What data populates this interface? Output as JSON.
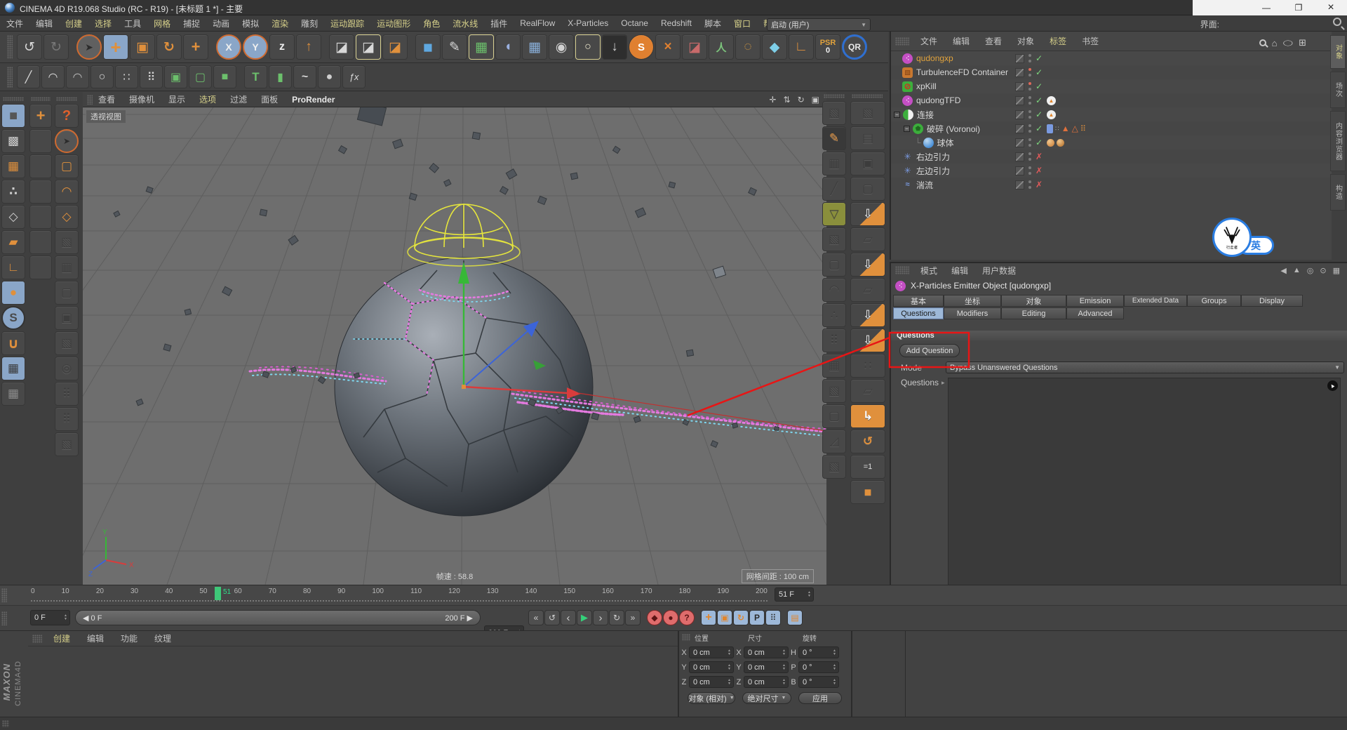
{
  "window": {
    "title": "CINEMA 4D R19.068 Studio (RC - R19) - [未标题 1 *] - 主要",
    "minimize": "—",
    "restore": "❐",
    "close": "×"
  },
  "menu": {
    "items": [
      {
        "t": "文件"
      },
      {
        "t": "编辑"
      },
      {
        "t": "创建",
        "css": "color:#d6d08a"
      },
      {
        "t": "选择",
        "css": "color:#d6d08a"
      },
      {
        "t": "工具"
      },
      {
        "t": "网格",
        "css": "color:#d6d08a"
      },
      {
        "t": "捕捉"
      },
      {
        "t": "动画"
      },
      {
        "t": "模拟"
      },
      {
        "t": "渲染",
        "css": "color:#d6d08a"
      },
      {
        "t": "雕刻"
      },
      {
        "t": "运动跟踪",
        "css": "color:#d6d08a"
      },
      {
        "t": "运动图形",
        "css": "color:#d6d08a"
      },
      {
        "t": "角色",
        "css": "color:#d6d08a"
      },
      {
        "t": "流水线",
        "css": "color:#d6d08a"
      },
      {
        "t": "插件"
      },
      {
        "t": "RealFlow"
      },
      {
        "t": "X-Particles"
      },
      {
        "t": "Octane"
      },
      {
        "t": "Redshift"
      },
      {
        "t": "脚本"
      },
      {
        "t": "窗口",
        "css": "color:#d6d08a"
      },
      {
        "t": "帮助",
        "css": "color:#d6d08a"
      }
    ],
    "interface_label": "界面:",
    "interface_value": "启动 (用户)"
  },
  "toolbar_main": {
    "icons": [
      {
        "n": "undo-icon",
        "g": "↺",
        "css": "color:#d8d8d8"
      },
      {
        "n": "redo-icon",
        "g": "↻",
        "css": "color:#777"
      },
      {
        "n": "sep",
        "g": "",
        "css": "width:7px;background:none;border:none;box-shadow:none"
      },
      {
        "n": "live-selection-icon",
        "g": "➤",
        "css": "color:#2b2b2b;background:#606060;border:2px solid #cf6a30;border-radius:50%;font-size:14px"
      },
      {
        "n": "move-tool-icon",
        "g": "+",
        "css": "background:#8aa6c8;color:#e0903c;font-weight:bold;font-size:26px"
      },
      {
        "n": "scale-tool-icon",
        "g": "▣",
        "css": "color:#e0903c"
      },
      {
        "n": "rotate-tool-icon",
        "g": "↻",
        "css": "color:#e0903c;font-weight:bold"
      },
      {
        "n": "last-tool-icon",
        "g": "+",
        "css": "color:#e0903c;font-weight:bold;font-size:22px"
      },
      {
        "n": "sep",
        "g": "",
        "css": "width:7px;background:none;border:none;box-shadow:none"
      },
      {
        "n": "lock-x-axis-icon",
        "g": "X",
        "css": "background:#8aa6c8;color:#f0f0f0;border:2px solid #cf6a30;border-radius:50%;font-weight:bold;font-size:14px"
      },
      {
        "n": "lock-y-axis-icon",
        "g": "Y",
        "css": "background:#8aa6c8;color:#f0f0f0;border:2px solid #cf6a30;border-radius:50%;font-weight:bold;font-size:14px"
      },
      {
        "n": "lock-z-axis-icon",
        "g": "z",
        "css": "color:#ececec;font-weight:bold;font-size:16px"
      },
      {
        "n": "coord-system-icon",
        "g": "↑",
        "css": "color:#e0903c;font-weight:bold"
      },
      {
        "n": "sep",
        "g": "",
        "css": "width:7px;background:none;border:none;box-shadow:none"
      },
      {
        "n": "render-view-icon",
        "g": "◪",
        "css": "color:#d8d8d8"
      },
      {
        "n": "render-settings-icon",
        "g": "◪",
        "css": "color:#d8d8d8;border:1px solid #d8d092"
      },
      {
        "n": "render-menu-icon",
        "g": "◪",
        "css": "color:#e0903c"
      },
      {
        "n": "sep",
        "g": "",
        "css": "width:7px;background:none;border:none;box-shadow:none"
      },
      {
        "n": "add-primitive-icon",
        "g": "■",
        "css": "color:#5fa8e0;font-size:23px"
      },
      {
        "n": "spline-pen-icon",
        "g": "✎",
        "css": "color:#d8d8d8"
      },
      {
        "n": "subdivision-surface-icon",
        "g": "▦",
        "css": "color:#6cc06c;border:1px solid #d8d092"
      },
      {
        "n": "deformer-icon",
        "g": "◖",
        "css": "color:#9ab0e0"
      },
      {
        "n": "workplane-icon",
        "g": "▦",
        "css": "color:#88aed8"
      },
      {
        "n": "camera-icon",
        "g": "◉",
        "css": "color:#d0d0d0"
      },
      {
        "n": "light-icon",
        "g": "○",
        "css": "color:#f2ecd2;border:1px solid #d8d092;font-size:16px"
      },
      {
        "n": "floor-icon",
        "g": "↓",
        "css": "background:#2e2e2e;color:#cfcfcf"
      },
      {
        "n": "sky-icon",
        "g": "S",
        "css": "background:#e08030;color:#fff;border-radius:50%;font-weight:bold;font-size:15px"
      },
      {
        "n": "xpresso-icon",
        "g": "×",
        "css": "color:#e08030;font-weight:bold"
      },
      {
        "n": "stage-icon",
        "g": "◪",
        "css": "color:#c86a6a"
      },
      {
        "n": "character-icon",
        "g": "人",
        "css": "color:#7cc47c;font-weight:bold;font-size:15px"
      },
      {
        "n": "hair-icon",
        "g": "◌",
        "css": "color:#e0a040;font-weight:bold"
      },
      {
        "n": "cloth-icon",
        "g": "◆",
        "css": "color:#7ecfe8"
      },
      {
        "n": "mograph-icon",
        "g": "∟",
        "css": "color:#e0903c;font-weight:bold"
      }
    ]
  },
  "toolbar_tools": {
    "icons": [
      {
        "n": "knife-tool-icon",
        "g": "╱",
        "css": "color:#d8d8d8"
      },
      {
        "n": "brush-tool-icon",
        "g": "◠",
        "css": "color:#d8d8d8"
      },
      {
        "n": "spline-arc-icon",
        "g": "◠",
        "css": "color:#b8b8b8"
      },
      {
        "n": "spline-circle-icon",
        "g": "○",
        "css": "color:#d8d8d8"
      },
      {
        "n": "array-tool-icon",
        "g": "∷",
        "css": "color:#d8d8d8"
      },
      {
        "n": "cluster-tool-icon",
        "g": "⠿",
        "css": "color:#d8d8d8"
      },
      {
        "n": "gear-cube-icon",
        "g": "▣",
        "css": "color:#6cc06c"
      },
      {
        "n": "cage-deform-icon",
        "g": "▢",
        "css": "color:#6cc06c"
      },
      {
        "n": "green-cube-icon",
        "g": "■",
        "css": "color:#6cc06c"
      },
      {
        "n": "sep",
        "g": "",
        "css": "width:7px;background:none;border:none;box-shadow:none"
      },
      {
        "n": "text-tool-icon",
        "g": "T",
        "css": "color:#6cc06c;font-weight:bold;font-size:17px"
      },
      {
        "n": "cylinder-tool-icon",
        "g": "▮",
        "css": "color:#6cc06c"
      },
      {
        "n": "spline-smooth-icon",
        "g": "~",
        "css": "color:#d8d8d8;font-weight:bold"
      },
      {
        "n": "shader-ball-icon",
        "g": "●",
        "css": "color:#cfcfcf"
      },
      {
        "n": "fx-tool-icon",
        "g": "ƒx",
        "css": "color:#d8d8d8;font-style:italic;font-size:13px"
      }
    ]
  },
  "left_modes": {
    "icons": [
      {
        "n": "model-mode-icon",
        "g": "■",
        "css": "background:#8aa6c8;color:#565656;font-size:20px"
      },
      {
        "n": "texture-mode-icon",
        "g": "▩",
        "css": "color:#d0d0d0"
      },
      {
        "n": "workplane-mode-icon",
        "g": "▦",
        "css": "color:#e0903c"
      },
      {
        "n": "points-mode-icon",
        "g": "∴",
        "css": "color:#d0d0d0;font-weight:bold"
      },
      {
        "n": "edges-mode-icon",
        "g": "◇",
        "css": "color:#d0d0d0"
      },
      {
        "n": "polygons-mode-icon",
        "g": "▰",
        "css": "color:#e0903c"
      },
      {
        "n": "axis-mode-icon",
        "g": "∟",
        "css": "color:#e0903c;font-weight:bold"
      },
      {
        "n": "tweak-mode-icon",
        "g": "●",
        "css": "background:#8aa6c8;color:#e0903c"
      },
      {
        "n": "soft-selection-icon",
        "g": "S",
        "css": "background:#8aa6c8;color:#4a4a4a;border:2px solid #333;border-radius:50%;font-weight:bold"
      },
      {
        "n": "snap-magnet-icon",
        "g": "∪",
        "css": "color:#e0903c;font-weight:bold;font-size:20px"
      },
      {
        "n": "workplane-lock-icon",
        "g": "▦",
        "css": "background:#8aa6c8;color:#3a3a3a"
      },
      {
        "n": "workplane-snap-icon",
        "g": "▦",
        "css": "color:#8a8a8a"
      }
    ]
  },
  "left_palette": {
    "icons": [
      {
        "n": "move-palette-icon",
        "g": "+",
        "css": "color:#e0903c;font-weight:bold;font-size:22px"
      },
      {
        "n": "empty-slot",
        "g": "",
        "css": ""
      },
      {
        "n": "empty-slot",
        "g": "",
        "css": ""
      },
      {
        "n": "empty-slot",
        "g": "",
        "css": ""
      },
      {
        "n": "empty-slot",
        "g": "",
        "css": ""
      },
      {
        "n": "empty-slot",
        "g": "",
        "css": ""
      },
      {
        "n": "empty-slot",
        "g": "",
        "css": ""
      }
    ]
  },
  "left_select": {
    "icons": [
      {
        "n": "help-icon",
        "g": "?",
        "css": "color:#e0602c;font-weight:bold;font-size:20px"
      },
      {
        "n": "live-select-icon",
        "g": "➤",
        "css": "color:#2b2b2b;background:#555;border:2px solid #cf6a30;border-radius:50%;font-size:12px"
      },
      {
        "n": "rect-select-icon",
        "g": "▢",
        "css": "color:#e0903c"
      },
      {
        "n": "lasso-select-icon",
        "g": "◠",
        "css": "color:#e0903c;font-weight:bold"
      },
      {
        "n": "poly-select-icon",
        "g": "◇",
        "css": "color:#e0903c"
      },
      {
        "n": "disabled-tool-icon",
        "g": "▧",
        "css": "color:#3d3d3d;text-shadow:0 1px 0 #5d5d5d"
      },
      {
        "n": "disabled-tool-icon",
        "g": "▥",
        "css": "color:#3d3d3d;text-shadow:0 1px 0 #5d5d5d"
      },
      {
        "n": "disabled-tool-icon",
        "g": "▢",
        "css": "color:#3d3d3d;text-shadow:0 1px 0 #5d5d5d"
      },
      {
        "n": "disabled-tool-icon",
        "g": "▣",
        "css": "color:#3d3d3d;text-shadow:0 1px 0 #5d5d5d"
      },
      {
        "n": "disabled-tool-icon",
        "g": "▧",
        "css": "color:#3d3d3d;text-shadow:0 1px 0 #5d5d5d"
      },
      {
        "n": "disabled-tool-icon",
        "g": "◎",
        "css": "color:#3d3d3d;text-shadow:0 1px 0 #5d5d5d"
      },
      {
        "n": "disabled-tool-icon",
        "g": "⠿",
        "css": "color:#3d3d3d;text-shadow:0 1px 0 #5d5d5d"
      },
      {
        "n": "disabled-tool-icon",
        "g": "⠿",
        "css": "color:#3d3d3d;text-shadow:0 1px 0 #5d5d5d"
      },
      {
        "n": "disabled-tool-icon",
        "g": "▧",
        "css": "color:#3d3d3d;text-shadow:0 1px 0 #5d5d5d"
      }
    ]
  },
  "right_strip_a": {
    "icons": [
      {
        "n": "mesh-tool-icon",
        "g": "▧",
        "css": ""
      },
      {
        "n": "polygon-pen-icon",
        "g": "✎",
        "css": "color:#e0903c;background:#393939"
      },
      {
        "n": "knife-lines-icon",
        "g": "▥",
        "css": ""
      },
      {
        "n": "knife-icon",
        "g": "╱",
        "css": "color:#3d3d3d;text-shadow:0 1px 0 #5d5d5d"
      },
      {
        "n": "cone-tool-icon",
        "g": "▽",
        "css": "background:#8a8f3c;color:#4f522a"
      },
      {
        "n": "cube-tool-icon",
        "g": "▧",
        "css": ""
      },
      {
        "n": "cube-tool-icon",
        "g": "▢",
        "css": ""
      },
      {
        "n": "arch-tool-icon",
        "g": "◠",
        "css": ""
      },
      {
        "n": "scatter-tool-icon",
        "g": "∴",
        "css": ""
      },
      {
        "n": "clamp-tool-icon",
        "g": "⠿",
        "css": ""
      },
      {
        "n": "grid-tool-icon",
        "g": "▦",
        "css": ""
      },
      {
        "n": "cube-tool-icon",
        "g": "▧",
        "css": ""
      },
      {
        "n": "cube-tool-icon",
        "g": "▢",
        "css": ""
      },
      {
        "n": "bevel-tool-icon",
        "g": "◿",
        "css": ""
      },
      {
        "n": "cube-tool-icon",
        "g": "▧",
        "css": ""
      }
    ]
  },
  "right_strip_b": {
    "icons": [
      {
        "n": "cubes-stack-icon",
        "g": "▧",
        "css": ""
      },
      {
        "n": "bricks-icon",
        "g": "▤",
        "css": ""
      },
      {
        "n": "cube-dots-icon",
        "g": "▣",
        "css": ""
      },
      {
        "n": "cube-icon",
        "g": "▢",
        "css": ""
      },
      {
        "n": "state-to-object-icon",
        "g": "⇩",
        "css": "color:#f0f0f0;background:linear-gradient(135deg,#474747 55%,#e0903c 56%)"
      },
      {
        "n": "polys-icon",
        "g": "▱",
        "css": ""
      },
      {
        "n": "connect-objects-icon",
        "g": "⇩",
        "css": "color:#f0f0f0;background:linear-gradient(135deg,#474747 55%,#e0903c 56%)"
      },
      {
        "n": "polys-icon",
        "g": "▱",
        "css": ""
      },
      {
        "n": "connect-delete-icon",
        "g": "⇩",
        "css": "color:#f0f0f0;background:linear-gradient(135deg,#474747 55%,#e0903c 56%)"
      },
      {
        "n": "bake-object-icon",
        "g": "⇩",
        "css": "color:#f0f0f0;background:linear-gradient(135deg,#474747 55%,#e0903c 56%)"
      },
      {
        "n": "dots-equal-icon",
        "g": "∷",
        "css": ""
      },
      {
        "n": "polys-icon",
        "g": "▱",
        "css": ""
      },
      {
        "n": "current-state-icon",
        "g": "↳",
        "css": "background:#e0903c;color:#fff;font-weight:bold"
      },
      {
        "n": "recycle-icon",
        "g": "↺",
        "css": "color:#e0903c;font-weight:bold"
      },
      {
        "n": "equal-one-icon",
        "g": "=1",
        "css": "color:#d8d8d8;font-size:11px"
      },
      {
        "n": "orange-cube-icon",
        "g": "■",
        "css": "color:#e0903c;font-size:18px"
      }
    ]
  },
  "viewport": {
    "menu_items": [
      {
        "t": "查看"
      },
      {
        "t": "摄像机"
      },
      {
        "t": "显示"
      },
      {
        "t": "选项",
        "css": "color:#d6d08a"
      },
      {
        "t": "过滤"
      },
      {
        "t": "面板"
      },
      {
        "t": "ProRender",
        "css": "color:#e8e8e8;font-weight:bold"
      }
    ],
    "view_label": "透视视图",
    "fps": "帧速 : 58.8",
    "grid_spacing": "网格间距 : 100 cm"
  },
  "object_manager": {
    "menu": [
      {
        "t": "文件"
      },
      {
        "t": "编辑"
      },
      {
        "t": "查看"
      },
      {
        "t": "对象"
      },
      {
        "t": "标签",
        "css": "color:#d6d08a"
      },
      {
        "t": "书签"
      }
    ],
    "objects": [
      {
        "name": "qudongxp"
      },
      {
        "name": "TurbulenceFD Container"
      },
      {
        "name": "xpKill"
      },
      {
        "name": "qudongTFD"
      },
      {
        "name": "连接"
      },
      {
        "name": "破碎 (Voronoi)"
      },
      {
        "name": "球体"
      },
      {
        "name": "右边引力"
      },
      {
        "name": "左边引力"
      },
      {
        "name": "湍流"
      }
    ],
    "side_tabs": [
      "对象",
      "场次",
      "内容浏览器",
      "构造"
    ]
  },
  "attributes": {
    "menu": [
      {
        "t": "模式"
      },
      {
        "t": "编辑"
      },
      {
        "t": "用户数据"
      }
    ],
    "title": "X-Particles Emitter Object [qudongxp]",
    "tabs_row1": [
      {
        "t": "基本"
      },
      {
        "t": "坐标"
      },
      {
        "t": "对象"
      },
      {
        "t": "Emission"
      },
      {
        "t": "Extended Data"
      },
      {
        "t": "Groups"
      },
      {
        "t": "Display"
      }
    ],
    "tabs_row2": [
      {
        "t": "Questions",
        "css": "background:#9db8d8;color:#1c1c1c"
      },
      {
        "t": "Modifiers"
      },
      {
        "t": "Editing"
      },
      {
        "t": "Advanced"
      }
    ],
    "section_header": "Questions",
    "add_button": "Add Question",
    "mode_label": "Mode",
    "mode_value": "Bypass Unanswered Questions",
    "questions_label": "Questions"
  },
  "timeline": {
    "ticks": [
      "0",
      "10",
      "20",
      "30",
      "40",
      "50",
      "60",
      "70",
      "80",
      "90",
      "100",
      "110",
      "120",
      "130",
      "140",
      "150",
      "160",
      "170",
      "180",
      "190",
      "200"
    ],
    "marker_label": "51",
    "frame_box": "51 F",
    "start_value": "0 F",
    "range_left": "◀ 0 F",
    "range_right": "200 F ▶",
    "end_value": "200 F"
  },
  "transport": {
    "buttons": [
      {
        "n": "goto-start-button",
        "g": "«",
        "css": ""
      },
      {
        "n": "prev-key-button",
        "g": "↺",
        "css": ""
      },
      {
        "n": "prev-frame-button",
        "g": "‹",
        "css": "font-size:15px"
      },
      {
        "n": "play-button",
        "g": "▶",
        "css": "color:#35d07a;font-size:13px"
      },
      {
        "n": "next-frame-button",
        "g": "›",
        "css": "font-size:15px"
      },
      {
        "n": "next-key-button",
        "g": "↻",
        "css": ""
      },
      {
        "n": "goto-end-button",
        "g": "»",
        "css": "margin-right:8px"
      },
      {
        "n": "record-key-button",
        "g": "◆",
        "css": "background:#df6c6c;border-color:#7e2727;color:#5c1414;border-radius:50%"
      },
      {
        "n": "autokey-button",
        "g": "●",
        "css": "background:#df6c6c;border-color:#7e2727;color:#5c1414;border-radius:50%"
      },
      {
        "n": "key-selection-button",
        "g": "?",
        "css": "background:#df6c6c;border-color:#7e2727;color:#5c1414;border-radius:50%;font-weight:bold;margin-right:8px"
      },
      {
        "n": "anim-move-button",
        "g": "+",
        "css": "background:#9db8d8;color:#e0862e;font-weight:bold;font-size:16px"
      },
      {
        "n": "anim-scale-button",
        "g": "▣",
        "css": "background:#9db8d8;color:#e0862e"
      },
      {
        "n": "anim-rotate-button",
        "g": "↻",
        "css": "background:#9db8d8;color:#e0862e;font-weight:bold"
      },
      {
        "n": "anim-parameter-button",
        "g": "P",
        "css": "background:#9db8d8;color:#2b2b2b;font-weight:bold"
      },
      {
        "n": "anim-pla-button",
        "g": "⠿",
        "css": "background:#9db8d8;color:#2b2b2b;margin-right:8px"
      },
      {
        "n": "keyframe-panel-button",
        "g": "▤",
        "css": "background:#9db8d8;color:#e0862e"
      }
    ]
  },
  "materials": {
    "menu": [
      {
        "t": "创建",
        "css": "color:#d6d08a"
      },
      {
        "t": "编辑"
      },
      {
        "t": "功能"
      },
      {
        "t": "纹理"
      }
    ],
    "logo_top": "MAXON",
    "logo_bottom": "CINEMA4D"
  },
  "coordinates": {
    "headers": [
      "位置",
      "尺寸",
      "旋转"
    ],
    "rows": [
      {
        "a1": "X",
        "v1": "0 cm",
        "a2": "X",
        "v2": "0 cm",
        "a3": "H",
        "v3": "0 °"
      },
      {
        "a1": "Y",
        "v1": "0 cm",
        "a2": "Y",
        "v2": "0 cm",
        "a3": "P",
        "v3": "0 °"
      },
      {
        "a1": "Z",
        "v1": "0 cm",
        "a2": "Z",
        "v2": "0 cm",
        "a3": "B",
        "v3": "0 °"
      }
    ],
    "buttons": [
      "对象 (相对)",
      "绝对尺寸",
      "应用"
    ]
  },
  "overlay": {
    "lang_badge": "英",
    "badge_name": "行走者"
  }
}
